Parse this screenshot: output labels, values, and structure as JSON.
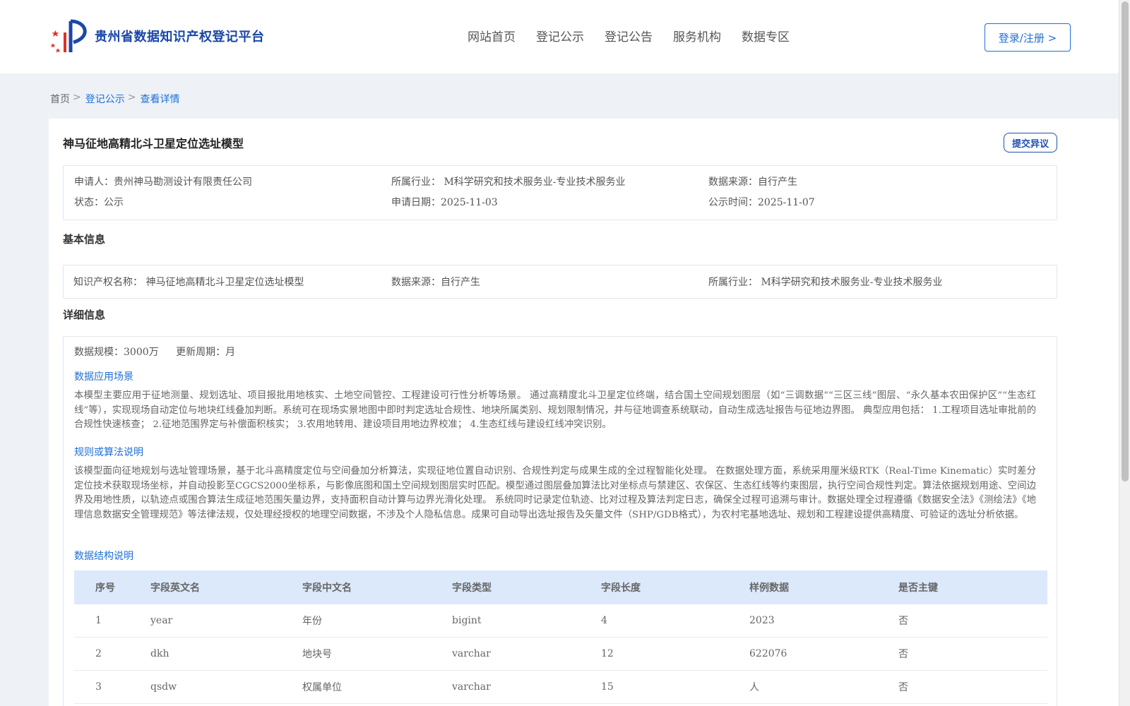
{
  "header": {
    "site_title": "贵州省数据知识产权登记平台",
    "nav": [
      "网站首页",
      "登记公示",
      "登记公告",
      "服务机构",
      "数据专区"
    ],
    "login_label": "登录/注册 >"
  },
  "breadcrumb": {
    "home": "首页",
    "sep": ">",
    "level2": "登记公示",
    "current": "查看详情"
  },
  "detail": {
    "title": "神马征地高精北斗卫星定位选址模型",
    "objection_label": "提交异议",
    "summary": {
      "applicant": "申请人：贵州神马勘测设计有限责任公司",
      "industry": "所属行业： M科学研究和技术服务业-专业技术服务业",
      "source": "数据来源：自行产生",
      "status": "状态：公示",
      "apply_date": "申请日期：2025-11-03",
      "publish_date": "公示时间：2025-11-07"
    },
    "basic": {
      "section_title": "基本信息",
      "ip_name": "知识产权名称： 神马征地高精北斗卫星定位选址模型",
      "source": "数据来源：自行产生",
      "industry": "所属行业： M科学研究和技术服务业-专业技术服务业"
    },
    "info": {
      "section_title": "详细信息",
      "scale": "数据规模：3000万",
      "cycle": "更新周期：月",
      "scenario_title": "数据应用场景",
      "scenario_text": "本模型主要应用于征地测量、规划选址、项目报批用地核实、土地空间管控、工程建设可行性分析等场景。 通过高精度北斗卫星定位终端，结合国土空间规划图层（如“三调数据”“三区三线”图层、“永久基本农田保护区”“生态红线”等），实现现场自动定位与地块红线叠加判断。系统可在现场实景地图中即时判定选址合规性、地块所属类别、规划限制情况，并与征地调查系统联动，自动生成选址报告与征地边界图。 典型应用包括： 1.工程项目选址审批前的合规性快速核查； 2.征地范围界定与补偿面积核实； 3.农用地转用、建设项目用地边界校准； 4.生态红线与建设红线冲突识别。",
      "algorithm_title": "规则或算法说明",
      "algorithm_text": "该模型面向征地规划与选址管理场景，基于北斗高精度定位与空间叠加分析算法，实现征地位置自动识别、合规性判定与成果生成的全过程智能化处理。 在数据处理方面，系统采用厘米级RTK（Real-Time Kinematic）实时差分定位技术获取现场坐标，并自动投影至CGCS2000坐标系，与影像底图和国土空间规划图层实时匹配。模型通过图层叠加算法比对坐标点与禁建区、农保区、生态红线等约束图层，执行空间合规性判定。算法依据规划用途、空间边界及用地性质，以轨迹点或围合算法生成征地范围矢量边界，支持面积自动计算与边界光滑化处理。 系统同时记录定位轨迹、比对过程及算法判定日志，确保全过程可追溯与审计。数据处理全过程遵循《数据安全法》《测绘法》《地理信息数据安全管理规范》等法律法规，仅处理经授权的地理空间数据，不涉及个人隐私信息。成果可自动导出选址报告及矢量文件（SHP/GDB格式），为农村宅基地选址、规划和工程建设提供高精度、可验证的选址分析依据。",
      "structure_title": "数据结构说明",
      "table": {
        "headers": [
          "序号",
          "字段英文名",
          "字段中文名",
          "字段类型",
          "字段长度",
          "样例数据",
          "是否主键"
        ],
        "rows": [
          [
            "1",
            "year",
            "年份",
            "bigint",
            "4",
            "2023",
            "否"
          ],
          [
            "2",
            "dkh",
            "地块号",
            "varchar",
            "12",
            "622076",
            "否"
          ],
          [
            "3",
            "qsdw",
            "权属单位",
            "varchar",
            "15",
            "人",
            "否"
          ]
        ]
      }
    }
  },
  "colors": {
    "brand": "#1a47a8",
    "link": "#1f6fd6",
    "table_header_bg": "#dbe9fb",
    "page_bg": "#eef2f7"
  }
}
